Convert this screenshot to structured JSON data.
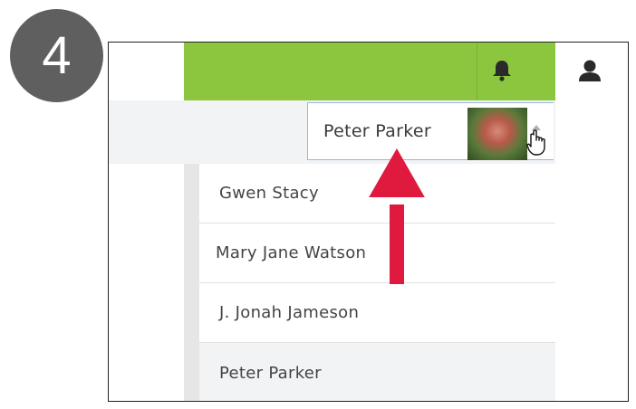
{
  "step_number": "4",
  "colors": {
    "header_green": "#8cc63f",
    "arrow_red": "#e0193f",
    "badge_gray": "#5f5f5f"
  },
  "header": {
    "icons": [
      "bell-icon",
      "user-icon"
    ]
  },
  "account_selector": {
    "selected_name": "Peter Parker",
    "caret": "caret-up-icon"
  },
  "menu": {
    "items": [
      {
        "label": "Gwen Stacy"
      },
      {
        "label": "Mary Jane Watson"
      },
      {
        "label": "J. Jonah Jameson"
      },
      {
        "label": "Peter Parker"
      }
    ]
  }
}
